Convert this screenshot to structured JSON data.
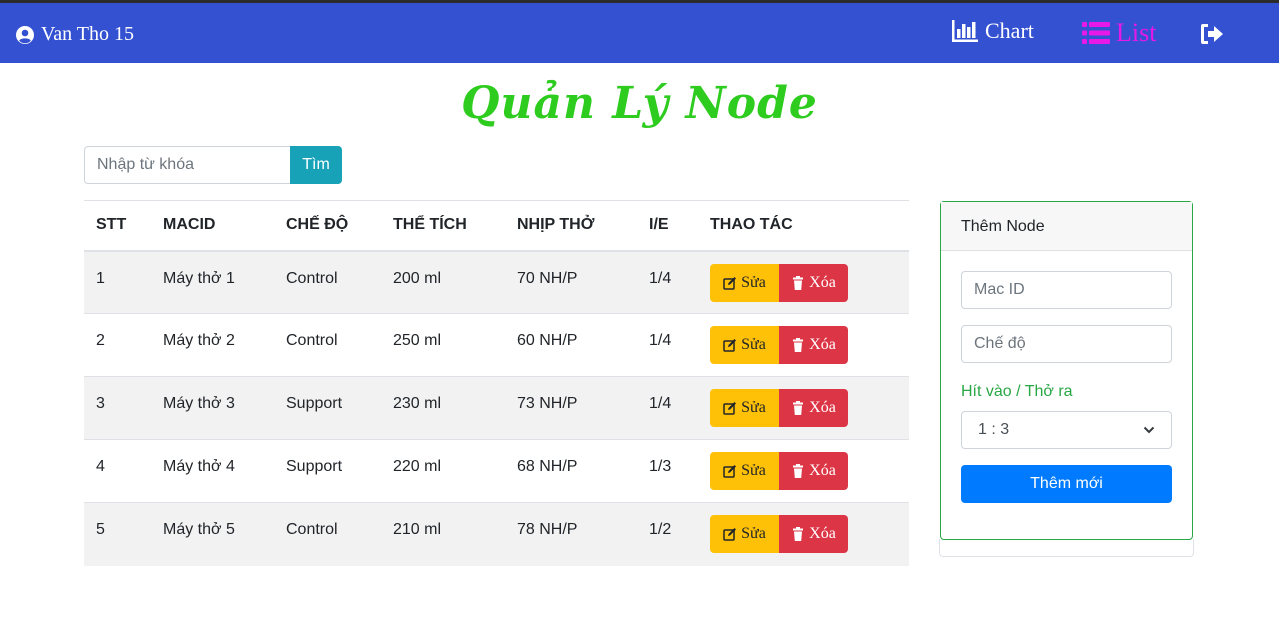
{
  "header": {
    "user_name": "Van Tho 15",
    "nav_chart": "Chart",
    "nav_list": "List"
  },
  "page": {
    "title": "Quản Lý Node"
  },
  "search": {
    "placeholder": "Nhập từ khóa",
    "button": "Tìm"
  },
  "table": {
    "columns": [
      "STT",
      "MACID",
      "CHẾ ĐỘ",
      "THỂ TÍCH",
      "NHỊP THỞ",
      "I/E",
      "THAO TÁC"
    ],
    "rows": [
      {
        "stt": "1",
        "macid": "Máy thở 1",
        "mode": "Control",
        "volume": "200 ml",
        "rate": "70 NH/P",
        "ie": "1/4"
      },
      {
        "stt": "2",
        "macid": "Máy thở 2",
        "mode": "Control",
        "volume": "250 ml",
        "rate": "60 NH/P",
        "ie": "1/4"
      },
      {
        "stt": "3",
        "macid": "Máy thở 3",
        "mode": "Support",
        "volume": "230 ml",
        "rate": "73 NH/P",
        "ie": "1/4"
      },
      {
        "stt": "4",
        "macid": "Máy thở 4",
        "mode": "Support",
        "volume": "220 ml",
        "rate": "68 NH/P",
        "ie": "1/3"
      },
      {
        "stt": "5",
        "macid": "Máy thở 5",
        "mode": "Control",
        "volume": "210 ml",
        "rate": "78 NH/P",
        "ie": "1/2"
      }
    ],
    "edit_label": "Sửa",
    "delete_label": "Xóa"
  },
  "form": {
    "header": "Thêm Node",
    "mac_placeholder": "Mac ID",
    "mode_placeholder": "Chế độ",
    "ie_label": "Hít vào / Thở ra",
    "ie_selected": "1 : 3",
    "submit": "Thêm mới"
  },
  "colors": {
    "navbar": "#3451d1",
    "active_nav": "#e619e6",
    "title": "#2ecc1e",
    "edit": "#ffc107",
    "delete": "#dc3545",
    "primary": "#007bff",
    "info": "#17a2b8"
  },
  "icons": [
    "user-circle-icon",
    "bar-chart-icon",
    "list-icon",
    "logout-icon",
    "edit-icon",
    "trash-icon",
    "chevron-down-icon"
  ]
}
